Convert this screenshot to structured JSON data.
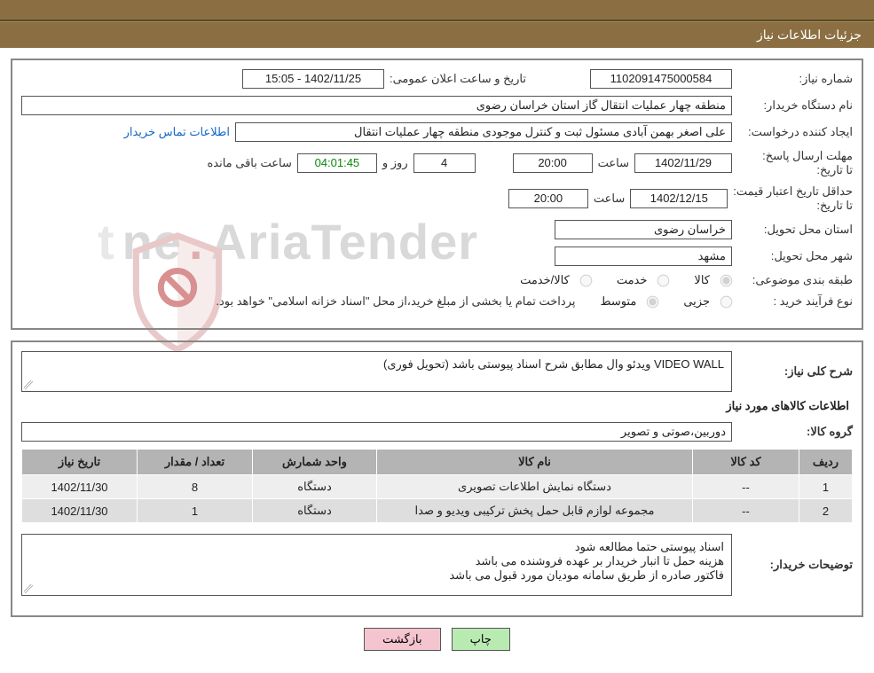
{
  "header": {
    "title": "جزئیات اطلاعات نیاز"
  },
  "watermark": {
    "brand_part1": "AriaTender",
    "brand_dot": ".",
    "brand_part2": "ne",
    "brand_part3": "t"
  },
  "info": {
    "need_no_label": "شماره نیاز:",
    "need_no": "1102091475000584",
    "announce_label": "تاریخ و ساعت اعلان عمومی:",
    "announce_value": "1402/11/25 - 15:05",
    "buyer_org_label": "نام دستگاه خریدار:",
    "buyer_org": "منطقه چهار عملیات انتقال گاز   استان خراسان رضوی",
    "requester_label": "ایجاد کننده درخواست:",
    "requester": "علی اصغر بهمن آبادی مسئول ثبت و کنترل موجودی منطقه چهار عملیات انتقال ",
    "contact_link": "اطلاعات تماس خریدار",
    "answer_deadline_label": "مهلت ارسال پاسخ:",
    "to_date_label": "تا تاریخ:",
    "answer_date": "1402/11/29",
    "time_label": "ساعت",
    "answer_time": "20:00",
    "days_label": "روز و",
    "days_remaining": "4",
    "countdown": "04:01:45",
    "time_remaining_label": "ساعت باقی مانده",
    "price_valid_label": "حداقل تاریخ اعتبار قیمت:",
    "price_valid_date": "1402/12/15",
    "price_valid_time": "20:00",
    "province_label": "استان محل تحویل:",
    "province": "خراسان رضوی",
    "city_label": "شهر محل تحویل:",
    "city": "مشهد",
    "category_label": "طبقه بندی موضوعی:",
    "cat_goods": "کالا",
    "cat_service": "خدمت",
    "cat_goods_service": "کالا/خدمت",
    "purchase_type_label": "نوع فرآیند خرید :",
    "pt_partial": "جزیی",
    "pt_medium": "متوسط",
    "purchase_note": "پرداخت تمام یا بخشی از مبلغ خرید،از محل \"اسناد خزانه اسلامی\" خواهد بود."
  },
  "need": {
    "overall_label": "شرح کلی نیاز:",
    "overall_text": "VIDEO WALL  ویدئو وال مطابق شرح اسناد پیوستی باشد (تحویل فوری)",
    "items_header": "اطلاعات کالاهای مورد نیاز",
    "group_label": "گروه کالا:",
    "group_value": "دوربین،صوتی و تصویر",
    "table": {
      "headers": {
        "row": "ردیف",
        "code": "کد کالا",
        "name": "نام کالا",
        "unit": "واحد شمارش",
        "qty": "تعداد / مقدار",
        "date": "تاریخ نیاز"
      },
      "rows": [
        {
          "row": "1",
          "code": "--",
          "name": "دستگاه نمایش اطلاعات تصویری",
          "unit": "دستگاه",
          "qty": "8",
          "date": "1402/11/30"
        },
        {
          "row": "2",
          "code": "--",
          "name": "مجموعه لوازم قابل حمل پخش ترکیبی ویدیو و صدا",
          "unit": "دستگاه",
          "qty": "1",
          "date": "1402/11/30"
        }
      ]
    },
    "buyer_notes_label": "توضیحات خریدار:",
    "buyer_notes": "اسناد پیوستی حتما مطالعه شود\nهزینه حمل تا انبار خریدار بر عهده فروشنده می باشد\nفاکتور صادره از طریق سامانه مودیان مورد قبول می باشد"
  },
  "buttons": {
    "print": "چاپ",
    "back": "بازگشت"
  }
}
